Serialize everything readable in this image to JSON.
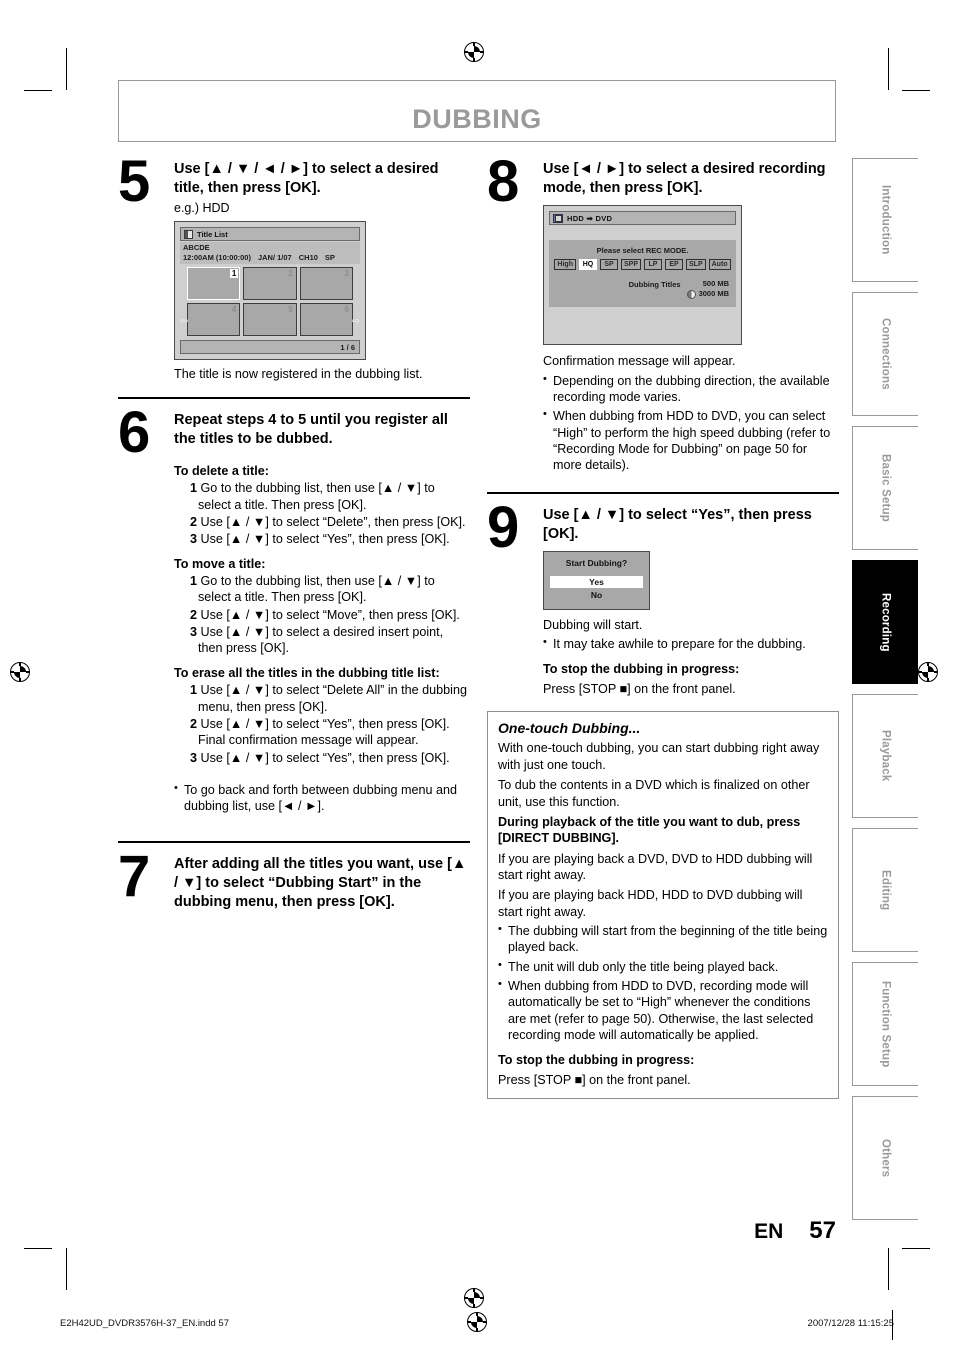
{
  "chapter": {
    "title": "DUBBING"
  },
  "steps": {
    "s5": {
      "num": "5",
      "title": "Use [▲ / ▼ / ◄ / ►] to select a desired title, then press [OK].",
      "eg": "e.g.) HDD",
      "caption": "The title is now registered in the dubbing list."
    },
    "s6": {
      "num": "6",
      "title": "Repeat steps 4 to 5 until you register all the titles to be dubbed.",
      "delete_head": "To delete a title:",
      "delete_items": [
        "Go to the dubbing list, then use [▲ / ▼] to select a title. Then press [OK].",
        "Use [▲ / ▼] to select “Delete”, then press [OK].",
        "Use [▲ / ▼] to select “Yes”, then press [OK]."
      ],
      "move_head": "To move a title:",
      "move_items": [
        "Go to the dubbing list, then use [▲ / ▼] to select a title. Then press [OK].",
        "Use [▲ / ▼] to select “Move”, then press [OK].",
        "Use [▲ / ▼] to select a desired insert point, then press [OK]."
      ],
      "erase_head": "To erase all the titles in the dubbing title list:",
      "erase_items": [
        "Use [▲ / ▼] to select “Delete All” in the dubbing menu, then press [OK].",
        "Use [▲ / ▼] to select “Yes”, then press [OK]. Final confirmation message will appear.",
        "Use [▲ / ▼] to select “Yes”, then press [OK]."
      ],
      "note": "To go back and forth between dubbing menu and dubbing list, use [◄ / ►]."
    },
    "s7": {
      "num": "7",
      "title": "After adding all the titles you want, use [▲ / ▼] to select “Dubbing Start” in the dubbing menu, then press [OK]."
    },
    "s8": {
      "num": "8",
      "title": "Use [◄ / ►] to select a desired recording mode, then press [OK].",
      "after": "Confirmation message will appear.",
      "bullets": [
        "Depending on the dubbing direction, the available recording mode varies.",
        "When dubbing from HDD to DVD, you can select “High” to perform the high speed dubbing (refer to “Recording Mode for Dubbing” on page 50 for more details)."
      ]
    },
    "s9": {
      "num": "9",
      "title": "Use [▲ / ▼] to select “Yes”, then press [OK].",
      "after": "Dubbing will start.",
      "bullet": "It may take awhile to prepare for the dubbing.",
      "stop_head": "To stop the dubbing in progress:",
      "stop_text": "Press [STOP ■] on the front panel."
    }
  },
  "osd_title_list": {
    "bar_label": "Title List",
    "name": "ABCDE",
    "time": "12:00AM (10:00:00)",
    "date": "JAN/ 1/07",
    "channel": "CH10",
    "mode": "SP",
    "thumbs": [
      "1",
      "2",
      "3",
      "4",
      "5",
      "6"
    ],
    "selected_index": 0,
    "arrow_left": "⇦",
    "arrow_right": "⇨",
    "page_indicator": "1 / 6"
  },
  "osd_rec_mode": {
    "bar_label": "HDD ➡ DVD",
    "prompt": "Please select REC MODE.",
    "modes": [
      "High",
      "HQ",
      "SP",
      "SPP",
      "LP",
      "EP",
      "SLP",
      "Auto"
    ],
    "selected_mode": "HQ",
    "info_label": "Dubbing Titles",
    "value_used": "500 MB",
    "value_total": "3000 MB"
  },
  "osd_start_dubbing": {
    "title": "Start Dubbing?",
    "options": [
      "Yes",
      "No"
    ],
    "selected_option": "Yes"
  },
  "one_touch": {
    "title": "One-touch Dubbing...",
    "p1": "With one-touch dubbing, you can start dubbing right away with just one touch.",
    "p2": "To dub the contents in a DVD which is finalized on other unit, use this function.",
    "p3_bold": "During playback of the title you want to dub, press [DIRECT DUBBING].",
    "p4": "If you are playing back a DVD, DVD to HDD dubbing will start right away.",
    "p5": "If you are playing back HDD, HDD to DVD dubbing will start right away.",
    "bullets": [
      "The dubbing will start from the beginning of the title being played back.",
      "The unit will dub only the title being played back.",
      "When dubbing from HDD to DVD, recording mode will automatically be set to “High” whenever the conditions are met (refer to page 50). Otherwise, the last selected recording mode will automatically be applied."
    ],
    "stop_head": "To stop the dubbing in progress:",
    "stop_text": "Press [STOP ■] on the front panel."
  },
  "sidebar": {
    "tabs": [
      {
        "label": "Introduction",
        "active": false
      },
      {
        "label": "Connections",
        "active": false
      },
      {
        "label": "Basic Setup",
        "active": false
      },
      {
        "label": "Recording",
        "active": true
      },
      {
        "label": "Playback",
        "active": false
      },
      {
        "label": "Editing",
        "active": false
      },
      {
        "label": "Function Setup",
        "active": false
      },
      {
        "label": "Others",
        "active": false
      }
    ]
  },
  "footer": {
    "lang": "EN",
    "page_number": "57",
    "file_name": "E2H42UD_DVDR3576H-37_EN.indd  57",
    "timestamp": "2007/12/28  11:15:25"
  },
  "colors": {
    "chapter_gray": "#9a9a9a",
    "osd_bg": "#cfcfcf",
    "osd_panel": "#a8a8a8",
    "active_tab": "#000000"
  }
}
